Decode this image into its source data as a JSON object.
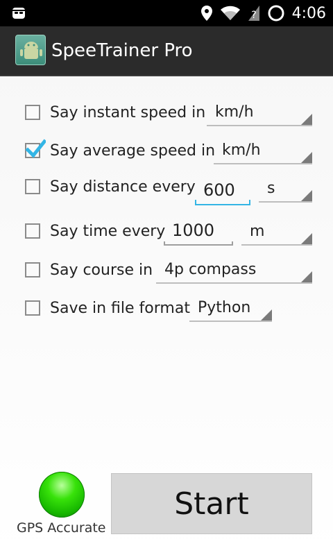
{
  "status_bar": {
    "time": "4:06"
  },
  "app_bar": {
    "title": "SpeeTrainer Pro"
  },
  "settings": {
    "instant_speed": {
      "checked": false,
      "label": "Say instant speed in",
      "unit": "km/h"
    },
    "average_speed": {
      "checked": true,
      "label": "Say average speed in",
      "unit": "km/h"
    },
    "distance": {
      "checked": false,
      "label": "Say distance every",
      "value": "600",
      "unit": "s"
    },
    "time": {
      "checked": false,
      "label": "Say time every",
      "value": "1000",
      "unit": "m"
    },
    "course": {
      "checked": false,
      "label": "Say course in",
      "value": "4p compass"
    },
    "save_file": {
      "checked": false,
      "label": "Save in file format",
      "value": "Python"
    }
  },
  "gps": {
    "label": "GPS Accurate",
    "status_color": "#38e20a"
  },
  "start_button": {
    "label": "Start"
  },
  "colors": {
    "accent": "#33b5e5",
    "check": "#33b5e5",
    "status_bar": "#000000",
    "action_bar": "#2b2b2b"
  }
}
